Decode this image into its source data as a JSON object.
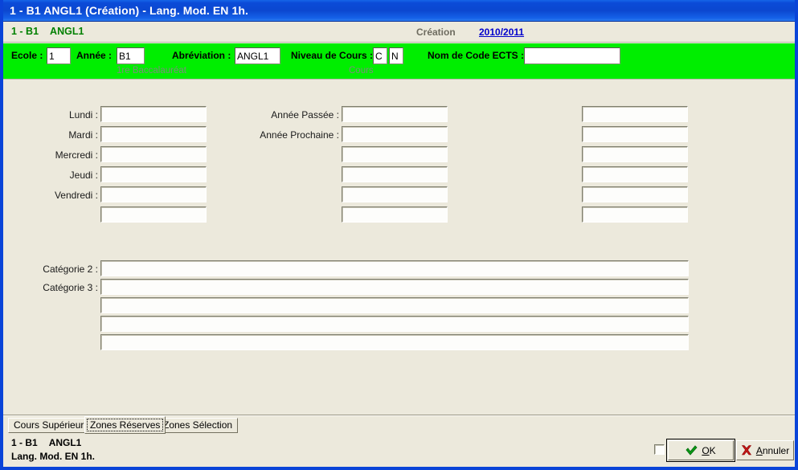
{
  "window": {
    "title": "1 - B1   ANGL1 (Création) - Lang. Mod. EN 1h.",
    "title_code": "1 - B1",
    "title_rest": "ANGL1 (Création) - Lang. Mod. EN 1h.",
    "border_color": "#0A44D8",
    "background": "#ECE9DC"
  },
  "info_row": {
    "code": "1 - B1",
    "abbrev": "ANGL1",
    "mode": "Création",
    "year_link": "2010/2011",
    "code_color": "#008000",
    "link_color": "#0000CC"
  },
  "green_band": {
    "background": "#00EE00",
    "fields": [
      {
        "label": "Ecole :",
        "value": "1",
        "sub": ""
      },
      {
        "label": "Année :",
        "value": "B1",
        "sub": "1re Baccalauréat"
      },
      {
        "label": "Abréviation :",
        "value": "ANGL1",
        "sub": ""
      },
      {
        "label": "Niveau de Cours :",
        "value": "C",
        "value2": "N",
        "sub": "Cours"
      },
      {
        "label": "Nom de Code ECTS :",
        "value": "",
        "sub": ""
      }
    ]
  },
  "form": {
    "column_left": {
      "labels": [
        "Lundi :",
        "Mardi :",
        "Mercredi :",
        "Jeudi :",
        "Vendredi :",
        ""
      ],
      "values": [
        "",
        "",
        "",
        "",
        "",
        ""
      ]
    },
    "column_middle": {
      "labels": [
        "Année Passée :",
        "Année Prochaine :",
        "",
        "",
        "",
        ""
      ],
      "values": [
        "",
        "",
        "",
        "",
        "",
        ""
      ]
    },
    "column_right": {
      "labels": [
        "",
        "",
        "",
        "",
        "",
        ""
      ],
      "values": [
        "",
        "",
        "",
        "",
        "",
        ""
      ]
    },
    "categories": {
      "labels": [
        "Catégorie 2 :",
        "Catégorie 3 :",
        "",
        "",
        ""
      ],
      "values": [
        "",
        "",
        "",
        "",
        ""
      ]
    }
  },
  "tabs": [
    {
      "label": "Cours Supérieur",
      "selected": false
    },
    {
      "label": "Zones Réserves",
      "selected": true
    },
    {
      "label": "Zones Sélection",
      "selected": false
    }
  ],
  "status": {
    "line1_code": "1 - B1",
    "line1_abbrev": "ANGL1",
    "line2": "Lang. Mod. EN 1h."
  },
  "buttons": {
    "checkbox_checked": false,
    "ok": {
      "label": "OK",
      "accel": "O",
      "icon": "check-icon",
      "icon_color": "#009900"
    },
    "cancel": {
      "label": "Annuler",
      "accel": "A",
      "icon": "x-icon",
      "icon_color": "#CC0000"
    }
  }
}
